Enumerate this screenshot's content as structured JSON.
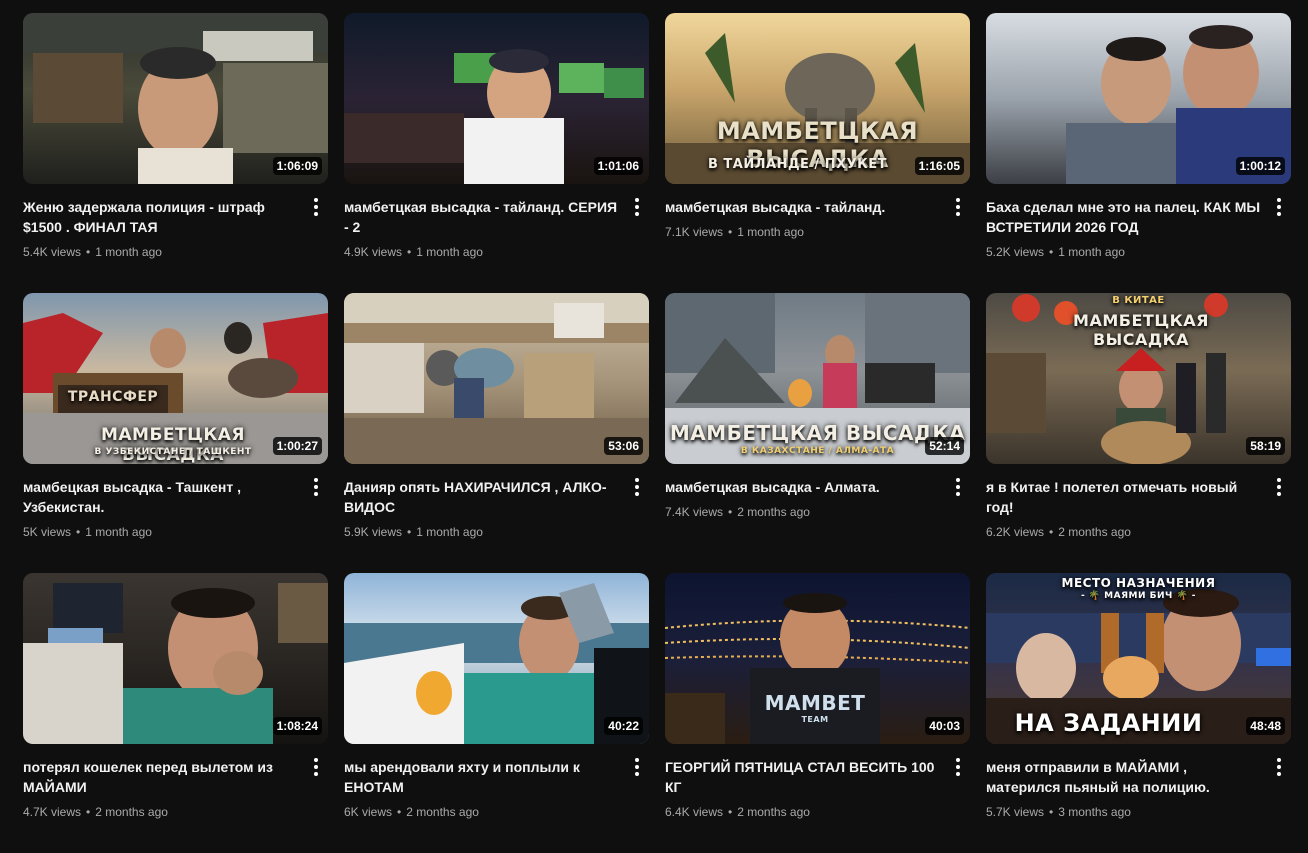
{
  "videos": [
    {
      "title": "Женю задержала полиция - штраф $1500 . ФИНАЛ ТАЯ",
      "views": "5.4K views",
      "age": "1 month ago",
      "duration": "1:06:09",
      "thumb_text": ""
    },
    {
      "title": "мамбетцкая высадка - тайланд. СЕРИЯ - 2",
      "views": "4.9K views",
      "age": "1 month ago",
      "duration": "1:01:06",
      "thumb_text": ""
    },
    {
      "title": "мамбетцкая высадка - тайланд.",
      "views": "7.1K views",
      "age": "1 month ago",
      "duration": "1:16:05",
      "thumb_text": "МАМБЕТЦКАЯ ВЫСАДКА",
      "thumb_subtext": "В ТАЙЛАНДЕ / ПХУКЕТ"
    },
    {
      "title": "Баха сделал мне это на палец. КАК МЫ ВСТРЕТИЛИ 2026 ГОД",
      "views": "5.2K views",
      "age": "1 month ago",
      "duration": "1:00:12",
      "thumb_text": ""
    },
    {
      "title": "мамбецкая высадка - Ташкент , Узбекистан.",
      "views": "5K views",
      "age": "1 month ago",
      "duration": "1:00:27",
      "thumb_text": "МАМБЕТЦКАЯ ВЫСАДКА",
      "thumb_subtext": "В УЗБЕКИСТАНЕ / ТАШКЕНТ",
      "thumb_sign": "ТРАНСФЕР"
    },
    {
      "title": "Данияр опять НАХИРАЧИЛСЯ , АЛКО-ВИДОС",
      "views": "5.9K views",
      "age": "1 month ago",
      "duration": "53:06",
      "thumb_text": ""
    },
    {
      "title": "мамбетцкая высадка - Алмата.",
      "views": "7.4K views",
      "age": "2 months ago",
      "duration": "52:14",
      "thumb_text": "МАМБЕТЦКАЯ ВЫСАДКА",
      "thumb_subtext": "В КАЗАХСТАНЕ / АЛМА-АТА"
    },
    {
      "title": "я в Китае ! полетел отмечать новый год!",
      "views": "6.2K views",
      "age": "2 months ago",
      "duration": "58:19",
      "thumb_text": "МАМБЕТЦКАЯ ВЫСАДКА",
      "thumb_subtext": "В КИТАЕ"
    },
    {
      "title": "потерял кошелек перед вылетом из МАЙАМИ",
      "views": "4.7K views",
      "age": "2 months ago",
      "duration": "1:08:24",
      "thumb_text": ""
    },
    {
      "title": "мы арендовали яхту и поплыли к ЕНОТАМ",
      "views": "6K views",
      "age": "2 months ago",
      "duration": "40:22",
      "thumb_text": ""
    },
    {
      "title": "ГЕОРГИЙ ПЯТНИЦА СТАЛ ВЕСИТЬ 100 КГ",
      "views": "6.4K views",
      "age": "2 months ago",
      "duration": "40:03",
      "thumb_text": "MAMBET",
      "thumb_subtext": "TEAM"
    },
    {
      "title": "меня отправили в МАЙАМИ , матерился пьяный на полицию.",
      "views": "5.7K views",
      "age": "3 months ago",
      "duration": "48:48",
      "thumb_text": "НА ЗАДАНИИ",
      "thumb_subtext": "МЕСТО НАЗНАЧЕНИЯ",
      "thumb_sign": "- 🌴 МАЯМИ БИЧ 🌴 -"
    }
  ],
  "icons": {
    "more": "more-vert-icon"
  }
}
